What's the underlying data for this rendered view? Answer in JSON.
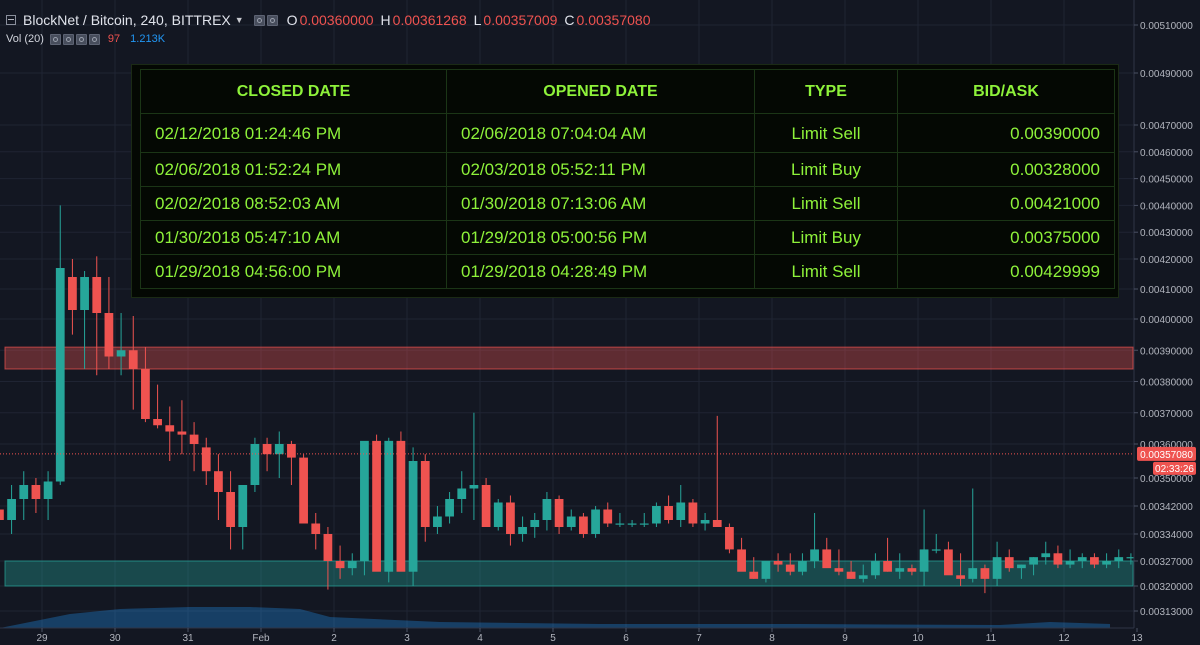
{
  "header": {
    "symbol": "BlockNet / Bitcoin, 240, BITTREX",
    "ohlc": [
      {
        "key": "O",
        "value": "0.00360000"
      },
      {
        "key": "H",
        "value": "0.00361268"
      },
      {
        "key": "L",
        "value": "0.00357009"
      },
      {
        "key": "C",
        "value": "0.00357080"
      }
    ],
    "volume": {
      "label": "Vol (20)",
      "red_value": "97",
      "blue_value": "1.213K"
    }
  },
  "trades": {
    "columns": [
      "CLOSED DATE",
      "OPENED DATE",
      "TYPE",
      "BID/ASK"
    ],
    "rows": [
      {
        "closed": "02/12/2018 01:24:46 PM",
        "opened": "02/06/2018 07:04:04 AM",
        "type": "Limit Sell",
        "bid_ask": "0.00390000"
      },
      {
        "closed": "02/06/2018 01:52:24 PM",
        "opened": "02/03/2018 05:52:11 PM",
        "type": "Limit Buy",
        "bid_ask": "0.00328000"
      },
      {
        "closed": "02/02/2018 08:52:03 AM",
        "opened": "01/30/2018 07:13:06 AM",
        "type": "Limit Sell",
        "bid_ask": "0.00421000"
      },
      {
        "closed": "01/30/2018 05:47:10 AM",
        "opened": "01/29/2018 05:00:56 PM",
        "type": "Limit Buy",
        "bid_ask": "0.00375000"
      },
      {
        "closed": "01/29/2018 04:56:00 PM",
        "opened": "01/29/2018 04:28:49 PM",
        "type": "Limit Sell",
        "bid_ask": "0.00429999"
      }
    ]
  },
  "chart_data": {
    "type": "candlestick",
    "x_ticks": [
      {
        "label": "29",
        "day": 0
      },
      {
        "label": "30",
        "day": 1
      },
      {
        "label": "31",
        "day": 2
      },
      {
        "label": "Feb",
        "day": 3
      },
      {
        "label": "2",
        "day": 4
      },
      {
        "label": "3",
        "day": 5
      },
      {
        "label": "4",
        "day": 6
      },
      {
        "label": "5",
        "day": 7
      },
      {
        "label": "6",
        "day": 8
      },
      {
        "label": "7",
        "day": 9
      },
      {
        "label": "8",
        "day": 10
      },
      {
        "label": "9",
        "day": 11
      },
      {
        "label": "10",
        "day": 12
      },
      {
        "label": "11",
        "day": 13
      },
      {
        "label": "12",
        "day": 14
      },
      {
        "label": "13",
        "day": 15
      }
    ],
    "y_ticks": [
      "0.00510000",
      "0.00490000",
      "0.00470000",
      "0.00460000",
      "0.00450000",
      "0.00440000",
      "0.00430000",
      "0.00420000",
      "0.00410000",
      "0.00400000",
      "0.00390000",
      "0.00380000",
      "0.00370000",
      "0.00360000",
      "0.00350000",
      "0.00342000",
      "0.00334000",
      "0.00327000",
      "0.00320000",
      "0.00313000"
    ],
    "last_price": "0.00357080",
    "countdown": "02:33:26",
    "zones": [
      {
        "name": "resistance",
        "from": 0.00384,
        "to": 0.00391,
        "color": "#ef5350"
      },
      {
        "name": "support",
        "from": 0.0032,
        "to": 0.00327,
        "color": "#26a69a"
      }
    ],
    "colors": {
      "up": "#26a69a",
      "down": "#ef5350",
      "volume": "#2196f3",
      "background": "#131722",
      "grid": "#1f2433"
    },
    "candles": [
      [
        3.413,
        3.42,
        3.25,
        3.27
      ],
      [
        3.42,
        3.47,
        3.37,
        3.41
      ],
      [
        3.41,
        3.44,
        3.32,
        3.38
      ],
      [
        3.38,
        3.48,
        3.34,
        3.44
      ],
      [
        3.44,
        3.52,
        3.38,
        3.48
      ],
      [
        3.48,
        3.5,
        3.4,
        3.44
      ],
      [
        3.44,
        3.52,
        3.38,
        3.49
      ],
      [
        3.49,
        4.4,
        3.48,
        4.17
      ],
      [
        4.14,
        4.2,
        3.95,
        4.03
      ],
      [
        4.03,
        4.16,
        3.84,
        4.14
      ],
      [
        4.14,
        4.21,
        3.82,
        4.02
      ],
      [
        4.02,
        4.14,
        3.84,
        3.88
      ],
      [
        3.88,
        4.02,
        3.82,
        3.9
      ],
      [
        3.9,
        4.01,
        3.71,
        3.84
      ],
      [
        3.84,
        3.91,
        3.67,
        3.68
      ],
      [
        3.68,
        3.79,
        3.65,
        3.66
      ],
      [
        3.66,
        3.72,
        3.55,
        3.64
      ],
      [
        3.64,
        3.74,
        3.57,
        3.63
      ],
      [
        3.63,
        3.67,
        3.52,
        3.6
      ],
      [
        3.59,
        3.62,
        3.48,
        3.52
      ],
      [
        3.52,
        3.57,
        3.38,
        3.46
      ],
      [
        3.46,
        3.52,
        3.3,
        3.36
      ],
      [
        3.36,
        3.45,
        3.3,
        3.48
      ],
      [
        3.48,
        3.62,
        3.46,
        3.6
      ],
      [
        3.6,
        3.62,
        3.52,
        3.57
      ],
      [
        3.57,
        3.64,
        3.5,
        3.6
      ],
      [
        3.6,
        3.61,
        3.48,
        3.56
      ],
      [
        3.56,
        3.57,
        3.37,
        3.37
      ],
      [
        3.37,
        3.4,
        3.3,
        3.34
      ],
      [
        3.34,
        3.36,
        3.19,
        3.27
      ],
      [
        3.27,
        3.31,
        3.22,
        3.25
      ],
      [
        3.25,
        3.29,
        3.23,
        3.27
      ],
      [
        3.27,
        3.51,
        3.23,
        3.61
      ],
      [
        3.61,
        3.63,
        3.28,
        3.24
      ],
      [
        3.24,
        3.62,
        3.21,
        3.61
      ],
      [
        3.61,
        3.64,
        3.26,
        3.24
      ],
      [
        3.24,
        3.59,
        3.2,
        3.55
      ],
      [
        3.55,
        3.57,
        3.32,
        3.36
      ],
      [
        3.36,
        3.42,
        3.34,
        3.39
      ],
      [
        3.39,
        3.46,
        3.37,
        3.44
      ],
      [
        3.44,
        3.52,
        3.4,
        3.47
      ],
      [
        3.47,
        3.7,
        3.38,
        3.48
      ],
      [
        3.48,
        3.5,
        3.36,
        3.36
      ],
      [
        3.36,
        3.44,
        3.35,
        3.43
      ],
      [
        3.43,
        3.45,
        3.31,
        3.34
      ],
      [
        3.34,
        3.39,
        3.32,
        3.36
      ],
      [
        3.36,
        3.4,
        3.33,
        3.38
      ],
      [
        3.38,
        3.46,
        3.35,
        3.44
      ],
      [
        3.44,
        3.45,
        3.34,
        3.36
      ],
      [
        3.36,
        3.41,
        3.35,
        3.39
      ],
      [
        3.39,
        3.4,
        3.33,
        3.34
      ],
      [
        3.34,
        3.42,
        3.33,
        3.41
      ],
      [
        3.41,
        3.43,
        3.36,
        3.37
      ],
      [
        3.37,
        3.4,
        3.36,
        3.37
      ],
      [
        3.37,
        3.38,
        3.36,
        3.37
      ],
      [
        3.37,
        3.4,
        3.36,
        3.37
      ],
      [
        3.37,
        3.43,
        3.36,
        3.42
      ],
      [
        3.42,
        3.45,
        3.37,
        3.38
      ],
      [
        3.38,
        3.48,
        3.36,
        3.43
      ],
      [
        3.43,
        3.44,
        3.36,
        3.37
      ],
      [
        3.37,
        3.4,
        3.35,
        3.38
      ],
      [
        3.38,
        3.69,
        3.36,
        3.36
      ],
      [
        3.36,
        3.37,
        3.29,
        3.3
      ],
      [
        3.3,
        3.33,
        3.27,
        3.24
      ],
      [
        3.24,
        3.28,
        3.22,
        3.22
      ],
      [
        3.22,
        3.27,
        3.21,
        3.27
      ],
      [
        3.27,
        3.29,
        3.24,
        3.26
      ],
      [
        3.26,
        3.29,
        3.23,
        3.24
      ],
      [
        3.24,
        3.29,
        3.23,
        3.27
      ],
      [
        3.27,
        3.4,
        3.25,
        3.3
      ],
      [
        3.3,
        3.33,
        3.26,
        3.25
      ],
      [
        3.25,
        3.3,
        3.23,
        3.24
      ],
      [
        3.24,
        3.27,
        3.22,
        3.22
      ],
      [
        3.22,
        3.26,
        3.21,
        3.23
      ],
      [
        3.23,
        3.29,
        3.22,
        3.27
      ],
      [
        3.27,
        3.33,
        3.24,
        3.24
      ],
      [
        3.24,
        3.29,
        3.22,
        3.25
      ],
      [
        3.25,
        3.26,
        3.23,
        3.24
      ],
      [
        3.24,
        3.41,
        3.2,
        3.3
      ],
      [
        3.3,
        3.34,
        3.29,
        3.3
      ],
      [
        3.3,
        3.32,
        3.24,
        3.23
      ],
      [
        3.23,
        3.29,
        3.2,
        3.22
      ],
      [
        3.22,
        3.47,
        3.21,
        3.25
      ],
      [
        3.25,
        3.26,
        3.18,
        3.22
      ],
      [
        3.22,
        3.32,
        3.2,
        3.28
      ],
      [
        3.28,
        3.3,
        3.24,
        3.25
      ],
      [
        3.25,
        3.26,
        3.22,
        3.26
      ],
      [
        3.26,
        3.28,
        3.23,
        3.28
      ],
      [
        3.28,
        3.32,
        3.26,
        3.29
      ],
      [
        3.29,
        3.31,
        3.25,
        3.26
      ],
      [
        3.26,
        3.3,
        3.25,
        3.27
      ],
      [
        3.27,
        3.29,
        3.25,
        3.28
      ],
      [
        3.28,
        3.29,
        3.25,
        3.26
      ],
      [
        3.26,
        3.29,
        3.25,
        3.27
      ],
      [
        3.27,
        3.3,
        3.25,
        3.28
      ],
      [
        3.28,
        3.29,
        3.26,
        3.28
      ],
      [
        3.28,
        3.29,
        3.26,
        3.26
      ],
      [
        3.26,
        3.29,
        3.25,
        3.28
      ],
      [
        3.28,
        3.3,
        3.26,
        3.3
      ],
      [
        3.3,
        3.33,
        3.28,
        3.28
      ],
      [
        3.28,
        3.31,
        3.28,
        3.3
      ],
      [
        3.3,
        3.31,
        3.26,
        3.29
      ],
      [
        3.29,
        3.31,
        3.27,
        3.3
      ],
      [
        3.3,
        3.34,
        3.29,
        3.32
      ],
      [
        3.31,
        3.38,
        3.29,
        3.44
      ],
      [
        3.44,
        3.91,
        3.43,
        3.71
      ],
      [
        3.71,
        3.8,
        3.66,
        3.75
      ],
      [
        3.75,
        3.76,
        3.62,
        3.66
      ],
      [
        3.66,
        3.76,
        3.63,
        3.75
      ],
      [
        3.75,
        3.79,
        3.57,
        3.61
      ],
      [
        3.61,
        3.62,
        3.6,
        3.6
      ],
      [
        3.6,
        3.61,
        3.57,
        3.57
      ]
    ]
  }
}
